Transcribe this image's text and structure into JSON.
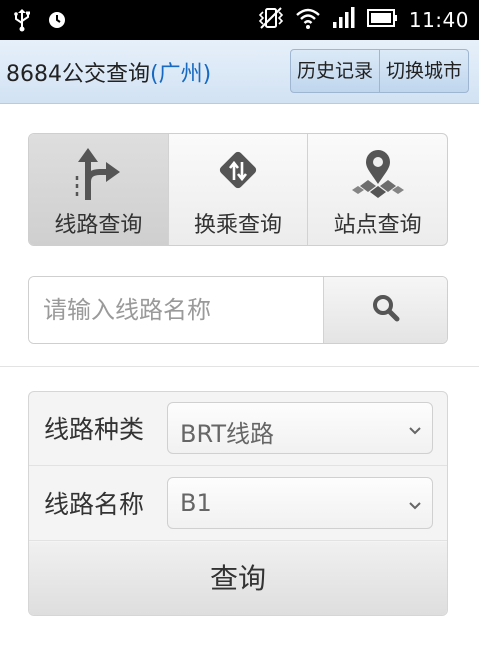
{
  "status_bar": {
    "time": "11:40",
    "icons": [
      "usb-icon",
      "alarm-icon",
      "vibrate-icon",
      "wifi-icon",
      "signal-icon",
      "battery-icon"
    ]
  },
  "header": {
    "title": "8684公交查询",
    "city": "(广州)",
    "history_label": "历史记录",
    "switch_city_label": "切换城市"
  },
  "tabs": [
    {
      "label": "线路查询",
      "icon": "route-icon",
      "active": true
    },
    {
      "label": "换乘查询",
      "icon": "transfer-icon",
      "active": false
    },
    {
      "label": "站点查询",
      "icon": "station-pin-icon",
      "active": false
    }
  ],
  "search": {
    "placeholder": "请输入线路名称",
    "value": "",
    "button_icon": "search-icon"
  },
  "form": {
    "type_label": "线路种类",
    "type_value": "BRT线路",
    "name_label": "线路名称",
    "name_value": "B1",
    "submit_label": "查询"
  },
  "colors": {
    "header_bg": "#d2e2f3",
    "city_text": "#1769c2",
    "icon_gray": "#555555"
  }
}
